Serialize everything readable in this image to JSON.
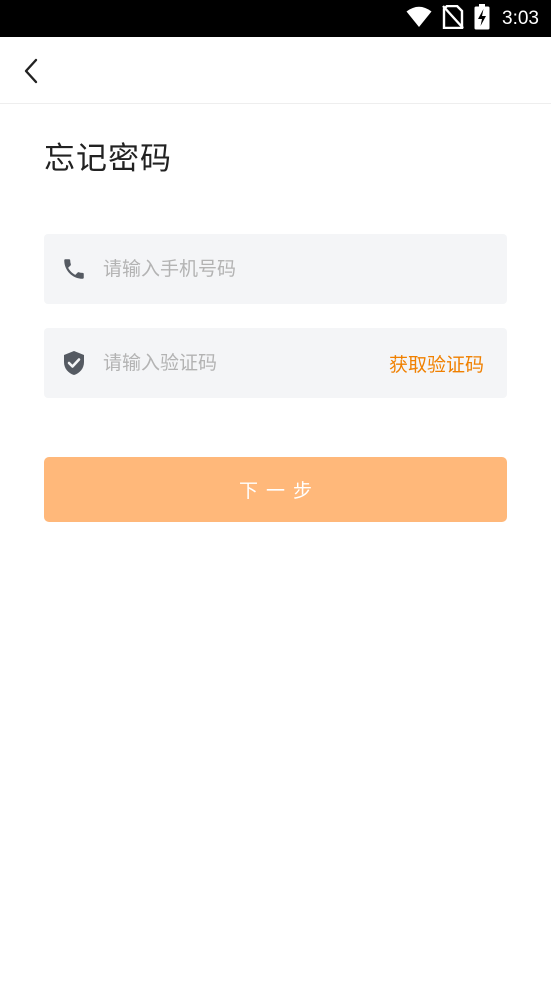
{
  "status_bar": {
    "time": "3:03",
    "icons": [
      "wifi-icon",
      "no-sim-icon",
      "battery-charging-icon"
    ]
  },
  "app_bar": {
    "back_icon": "chevron-left-icon"
  },
  "page": {
    "title": "忘记密码"
  },
  "form": {
    "phone": {
      "icon": "phone-icon",
      "value": "",
      "placeholder": "请输入手机号码"
    },
    "code": {
      "icon": "shield-check-icon",
      "value": "",
      "placeholder": "请输入验证码",
      "get_code_label": "获取验证码"
    },
    "next_label": "下一步"
  },
  "colors": {
    "accent": "#f08000",
    "button_bg": "#ffb87a",
    "button_text": "#ffffff",
    "field_bg": "#f4f5f7",
    "icon_gray": "#555a62"
  }
}
